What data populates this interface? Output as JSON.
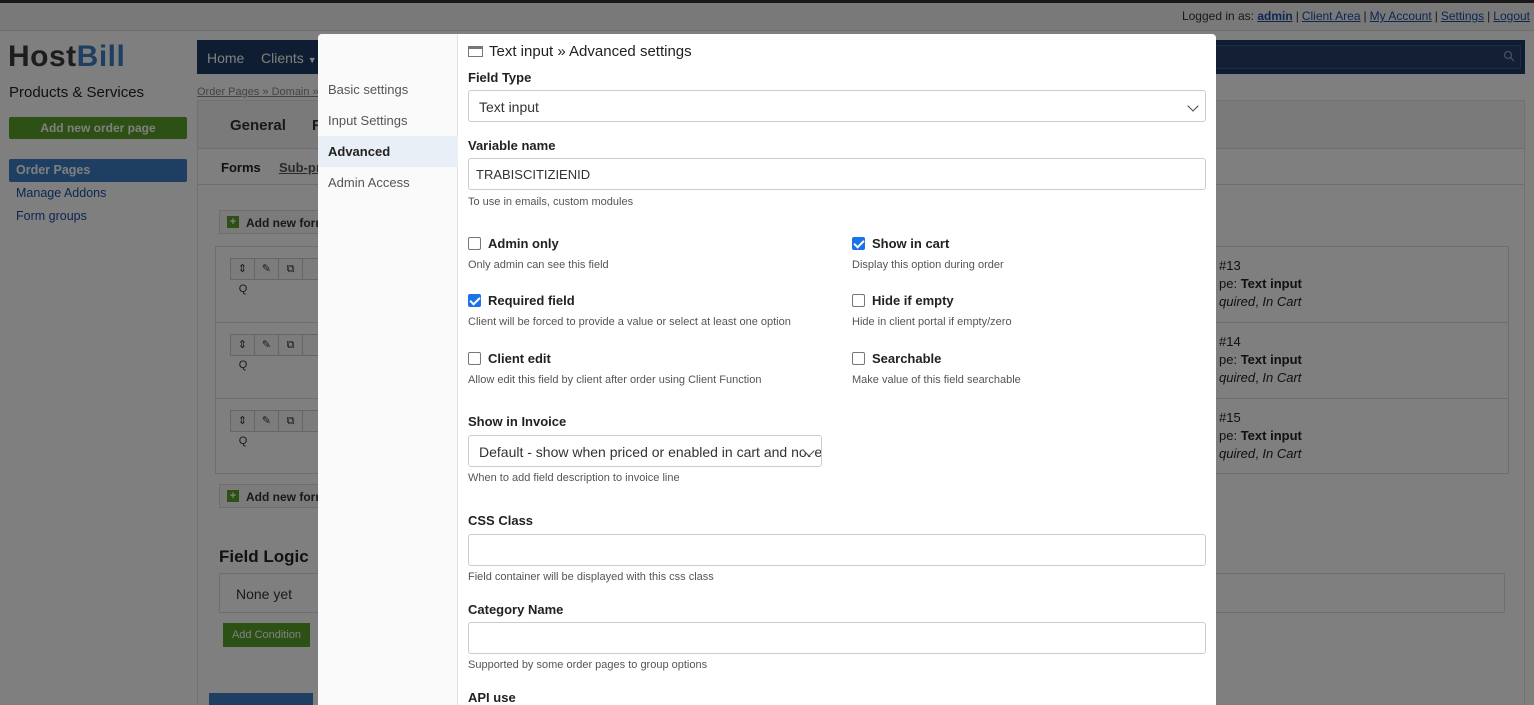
{
  "topbar": {
    "logged_in_as": "Logged in as:",
    "user": "admin",
    "links": [
      "Client Area",
      "My Account",
      "Settings",
      "Logout"
    ]
  },
  "logo": {
    "part1": "Host",
    "part2": "Bill"
  },
  "sidebar": {
    "title": "Products & Services",
    "add_button": "Add new order page",
    "items": [
      {
        "label": "Order Pages",
        "active": true
      },
      {
        "label": "Manage Addons",
        "active": false
      },
      {
        "label": "Form groups",
        "active": false
      }
    ]
  },
  "mainnav": {
    "items": [
      "Home",
      "Clients"
    ]
  },
  "breadcrumb": "Order Pages » Domain »",
  "content": {
    "tabs": [
      "General",
      "F"
    ],
    "subtabs": [
      "Forms",
      "Sub-pr"
    ],
    "add_form_label": "Add new form",
    "fields": [
      {
        "id": "#13",
        "type_prefix": "pe:",
        "type": "Text input",
        "flags_prefix": "quired",
        "flags_suffix": "In Cart"
      },
      {
        "id": "#14",
        "type_prefix": "pe:",
        "type": "Text input",
        "flags_prefix": "quired",
        "flags_suffix": "In Cart"
      },
      {
        "id": "#15",
        "type_prefix": "pe:",
        "type": "Text input",
        "flags_prefix": "quired",
        "flags_suffix": "In Cart"
      }
    ],
    "field_logic_title": "Field Logic",
    "field_logic_empty": "None yet",
    "add_condition": "Add Condition"
  },
  "modal": {
    "nav": [
      {
        "label": "Basic settings",
        "active": false
      },
      {
        "label": "Input Settings",
        "active": false
      },
      {
        "label": "Advanced",
        "active": true
      },
      {
        "label": "Admin Access",
        "active": false
      }
    ],
    "title": "Text input » Advanced settings",
    "field_type": {
      "label": "Field Type",
      "value": "Text input"
    },
    "variable_name": {
      "label": "Variable name",
      "value": "TRABISCITIZIENID",
      "help": "To use in emails, custom modules"
    },
    "checkboxes": [
      {
        "label": "Admin only",
        "help": "Only admin can see this field",
        "checked": false
      },
      {
        "label": "Show in cart",
        "help": "Display this option during order",
        "checked": true
      },
      {
        "label": "Required field",
        "help": "Client will be forced to provide a value or select at least one option",
        "checked": true
      },
      {
        "label": "Hide if empty",
        "help": "Hide in client portal if empty/zero",
        "checked": false
      },
      {
        "label": "Client edit",
        "help": "Allow edit this field by client after order using Client Function",
        "checked": false
      },
      {
        "label": "Searchable",
        "help": "Make value of this field searchable",
        "checked": false
      }
    ],
    "show_in_invoice": {
      "label": "Show in Invoice",
      "value": "Default - show when priced or enabled in cart and not empty",
      "help": "When to add field description to invoice line"
    },
    "css_class": {
      "label": "CSS Class",
      "value": "",
      "help": "Field container will be displayed with this css class"
    },
    "category_name": {
      "label": "Category Name",
      "value": "",
      "help": "Supported by some order pages to group options"
    },
    "api_use": {
      "label": "API use"
    }
  },
  "colors": {
    "accent": "#3d7fc4",
    "nav_bg": "#1d3a63",
    "green": "#5aa12b",
    "checkbox": "#1a73e8"
  }
}
